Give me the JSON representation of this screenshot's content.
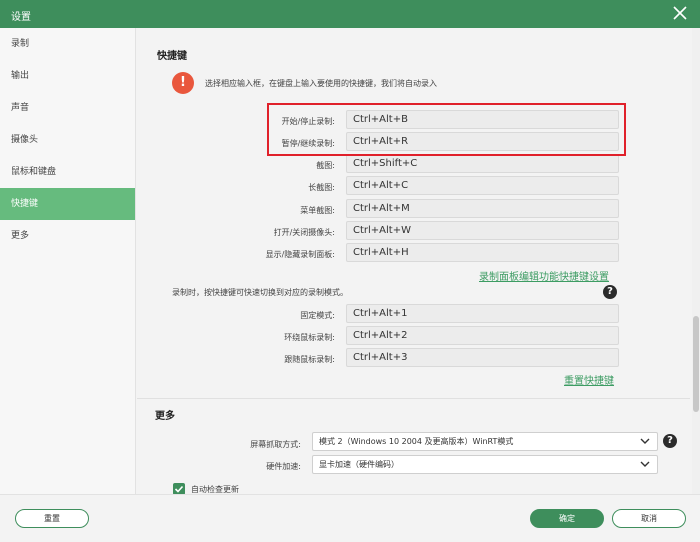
{
  "window": {
    "title": "设置"
  },
  "sidebar": {
    "items": [
      {
        "label": "录制"
      },
      {
        "label": "输出"
      },
      {
        "label": "声音"
      },
      {
        "label": "摄像头"
      },
      {
        "label": "鼠标和键盘"
      },
      {
        "label": "快捷键",
        "active": true
      },
      {
        "label": "更多"
      }
    ]
  },
  "hotkeys": {
    "section_title": "快捷键",
    "tip": "选择相应输入框，在键盘上输入要使用的快捷键，我们将自动录入",
    "rows": [
      {
        "label": "开始/停止录制:",
        "value": "Ctrl+Alt+B"
      },
      {
        "label": "暂停/继续录制:",
        "value": "Ctrl+Alt+R"
      },
      {
        "label": "截图:",
        "value": "Ctrl+Shift+C"
      },
      {
        "label": "长截图:",
        "value": "Ctrl+Alt+C"
      },
      {
        "label": "菜单截图:",
        "value": "Ctrl+Alt+M"
      },
      {
        "label": "打开/关闭摄像头:",
        "value": "Ctrl+Alt+W"
      },
      {
        "label": "显示/隐藏录制面板:",
        "value": "Ctrl+Alt+H"
      }
    ],
    "panel_settings_link": "录制面板编辑功能快捷键设置",
    "mode_note": "录制时，按快捷键可快速切换到对应的录制模式。",
    "help_icon": "?",
    "mode_rows": [
      {
        "label": "固定模式:",
        "value": "Ctrl+Alt+1"
      },
      {
        "label": "环绕鼠标录制:",
        "value": "Ctrl+Alt+2"
      },
      {
        "label": "跟随鼠标录制:",
        "value": "Ctrl+Alt+3"
      }
    ],
    "reset_link": "重置快捷键"
  },
  "more": {
    "section_title": "更多",
    "capture_mode": {
      "label": "屏幕抓取方式:",
      "value": "模式 2（Windows 10 2004 及更高版本）WinRT模式"
    },
    "hw_accel": {
      "label": "硬件加速:",
      "value": "显卡加速（硬件编码）"
    },
    "auto_update": {
      "label": "自动检查更新",
      "checked": true
    }
  },
  "footer": {
    "reset": "重置",
    "ok": "确定",
    "cancel": "取消"
  },
  "colors": {
    "brand_green": "#3e8e5c",
    "sidebar_active": "#66bb7e",
    "link_green": "#3d9c63",
    "alert_red": "#e9573d",
    "highlight_red": "#e0202a"
  }
}
